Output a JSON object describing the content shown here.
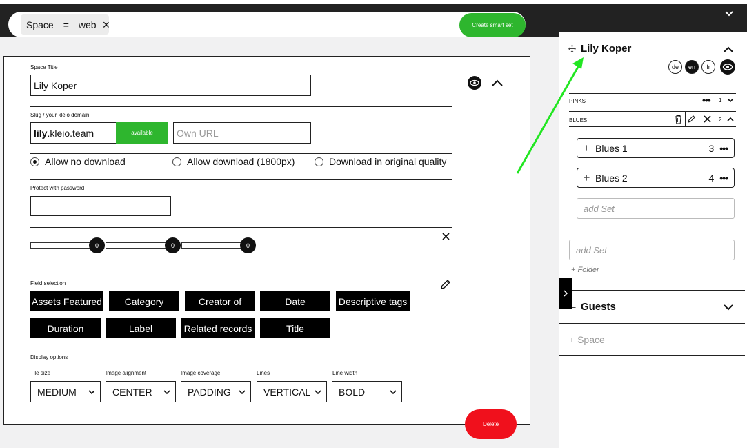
{
  "search": {
    "chip_field": "Space",
    "chip_op": "=",
    "chip_value": "web",
    "chip_remove": "×",
    "create_button": "Create smart set"
  },
  "form": {
    "title_label": "Space Title",
    "title_value": "Lily Koper",
    "slug_label": "Slug / your kleio domain",
    "slug_bold": "lily",
    "slug_rest": ".kleio.team",
    "slug_status": "available",
    "own_url_placeholder": "Own URL",
    "download_options": [
      "Allow no download",
      "Allow download (1800px)",
      "Download in original quality"
    ],
    "password_label": "Protect with password",
    "slider_values": [
      "0",
      "0",
      "0"
    ],
    "field_selection_label": "Field selection",
    "fields_row1": [
      "Assets Featured",
      "Category",
      "Creator of",
      "Date",
      "Descriptive tags"
    ],
    "fields_row2": [
      "Duration",
      "Label",
      "Related records",
      "Title"
    ],
    "display_label": "Display options",
    "display": [
      {
        "label": "Tile size",
        "value": "MEDIUM"
      },
      {
        "label": "Image alignment",
        "value": "CENTER"
      },
      {
        "label": "Image coverage",
        "value": "PADDING"
      },
      {
        "label": "Lines",
        "value": "VERTICAL"
      },
      {
        "label": "Line width",
        "value": "BOLD"
      }
    ],
    "delete_button": "Delete"
  },
  "panel": {
    "space_name": "Lily Koper",
    "languages": [
      "de",
      "en",
      "fr"
    ],
    "active_language": "en",
    "folders": [
      {
        "name": "PINKS",
        "count": "1"
      },
      {
        "name": "BLUES",
        "count": "2"
      }
    ],
    "sets": [
      {
        "name": "Blues 1",
        "count": "3"
      },
      {
        "name": "Blues 2",
        "count": "4"
      }
    ],
    "add_set_placeholder": "add Set",
    "add_folder": "+ Folder",
    "guests": "Guests",
    "add_space": "+ Space"
  },
  "colors": {
    "accent_green": "#2eb62e",
    "delete_red": "#f0101c",
    "annotation_arrow": "#22e622"
  }
}
